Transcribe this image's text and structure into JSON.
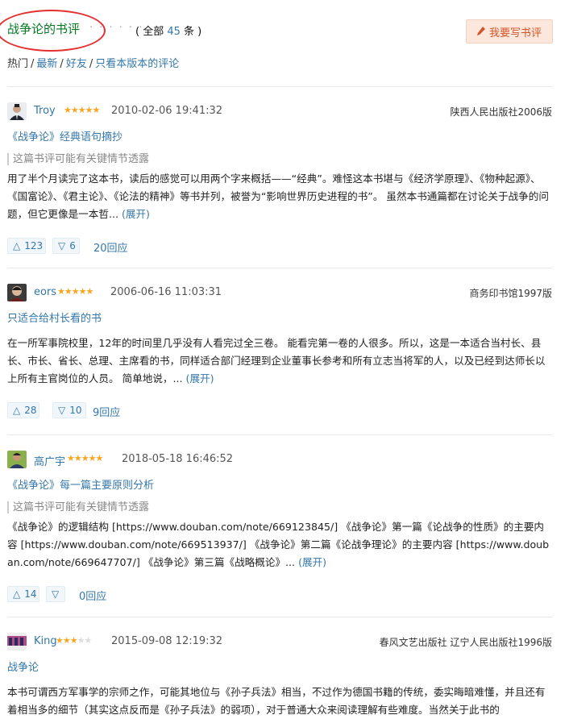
{
  "header": {
    "title": "战争论的书评",
    "dots": "· · · · · ·",
    "count_prefix": "( 全部 ",
    "count": "45",
    "count_suffix": " 条 )",
    "write_button": "我要写书评",
    "filters": [
      "热门",
      "最新",
      "好友",
      "只看本版本的评论"
    ],
    "filter_sep": "/"
  },
  "reviews": [
    {
      "user": "Troy",
      "rating": 5,
      "time": "2010-02-06 19:41:32",
      "edition": "陕西人民出版社2006版",
      "title": "《战争论》经典语句摘抄",
      "spoiler": "这篇书评可能有关键情节透露",
      "body": "用了半个月读完了这本书，读后的感觉可以用两个字来概括——“经典”。难怪这本书堪与《经济学原理》、《物种起源》、《国富论》、《君主论》、《论法的精神》等书并列，被誉为“影响世界历史进程的书”。 虽然本书通篇都在讨论关于战争的问题，但它更像是一本哲... ",
      "expand": "(展开)",
      "up": "123",
      "down": "6",
      "replies": "20回应"
    },
    {
      "user": "eors",
      "rating": 5,
      "time": "2006-06-16 11:03:31",
      "edition": "商务印书馆1997版",
      "title": "只适合给村长看的书",
      "spoiler": "",
      "body": "在一所军事院校里，12年的时间里几乎没有人看完过全三卷。 能看完第一卷的人很多。所以，这是一本适合当村长、县长、市长、省长、总理、主席看的书，同样适合部门经理到企业董事长参考和所有立志当将军的人，以及已经到达师长以上所有主官岗位的人员。 简单地说，... ",
      "expand": "(展开)",
      "up": "28",
      "down": "10",
      "replies": "9回应"
    },
    {
      "user": "高广宇",
      "rating": 5,
      "time": "2018-05-18 16:46:52",
      "edition": "",
      "title": "《战争论》每一篇主要原则分析",
      "spoiler": "这篇书评可能有关键情节透露",
      "body": "《战争论》的逻辑结构 [https://www.douban.com/note/669123845/] 《战争论》第一篇《论战争的性质》的主要内容 [https://www.douban.com/note/669513937/] 《战争论》第二篇《论战争理论》的主要内容 [https://www.douban.com/note/669647707/] 《战争论》第三篇《战略概论》... ",
      "expand": "(展开)",
      "up": "14",
      "down": "",
      "replies": "0回应"
    },
    {
      "user": "King",
      "rating": 3,
      "time": "2015-09-08 12:19:32",
      "edition": "春风文艺出版社 辽宁人民出版社1996版",
      "title": "战争论",
      "spoiler": "",
      "body": "本书可谓西方军事学的宗师之作，可能其地位与《孙子兵法》相当，不过作为德国书籍的传统，委实晦暗难懂，并且还有着相当多的细节（其实这点反而是《孙子兵法》的弱项），对于普通大众来阅读理解有些难度。当然关于此书的",
      "expand": "",
      "up": "",
      "down": "",
      "replies": ""
    }
  ],
  "colors": {
    "link": "#3377aa",
    "title_green": "#007722",
    "star": "#f6a623",
    "button_bg": "#fce7dd",
    "annotation": "#e53030"
  }
}
